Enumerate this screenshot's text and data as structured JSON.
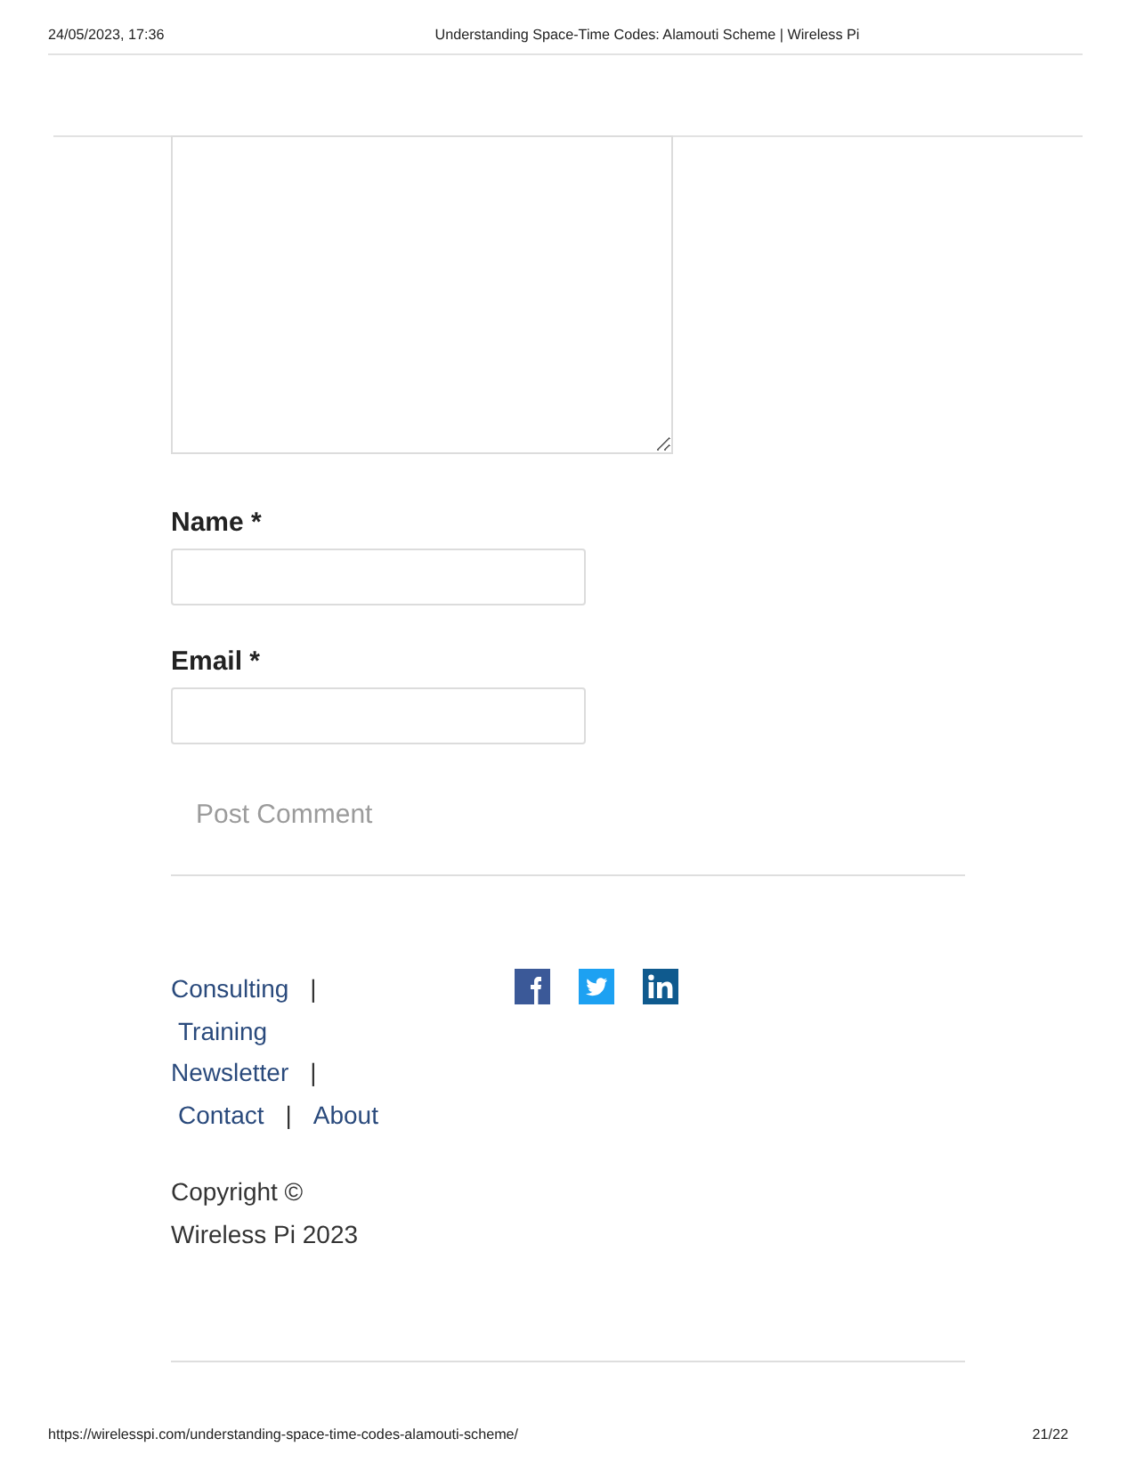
{
  "print_header": {
    "date": "24/05/2023, 17:36",
    "title": "Understanding Space-Time Codes: Alamouti Scheme | Wireless Pi"
  },
  "comment_form": {
    "fields": [
      {
        "kind": "textarea"
      },
      {
        "kind": "input",
        "label": "Name *"
      },
      {
        "kind": "input",
        "label": "Email *"
      }
    ],
    "submit_button": "Post Comment"
  },
  "footer": {
    "link_groups": [
      {
        "items": [
          {
            "kind": "link",
            "text": "Consulting"
          },
          {
            "kind": "separator",
            "text": "|"
          },
          {
            "kind": "link",
            "text": "Training"
          }
        ]
      },
      {
        "items": [
          {
            "kind": "link",
            "text": "Newsletter"
          },
          {
            "kind": "separator",
            "text": "|"
          },
          {
            "kind": "link",
            "text": "Contact"
          },
          {
            "kind": "separator",
            "text": "|"
          },
          {
            "kind": "link",
            "text": "About"
          }
        ]
      }
    ],
    "copyright": "Copyright © Wireless Pi 2023"
  },
  "print_footer": {
    "url": "https://wirelesspi.com/understanding-space-time-codes-alamouti-scheme/",
    "page": "21/22"
  }
}
